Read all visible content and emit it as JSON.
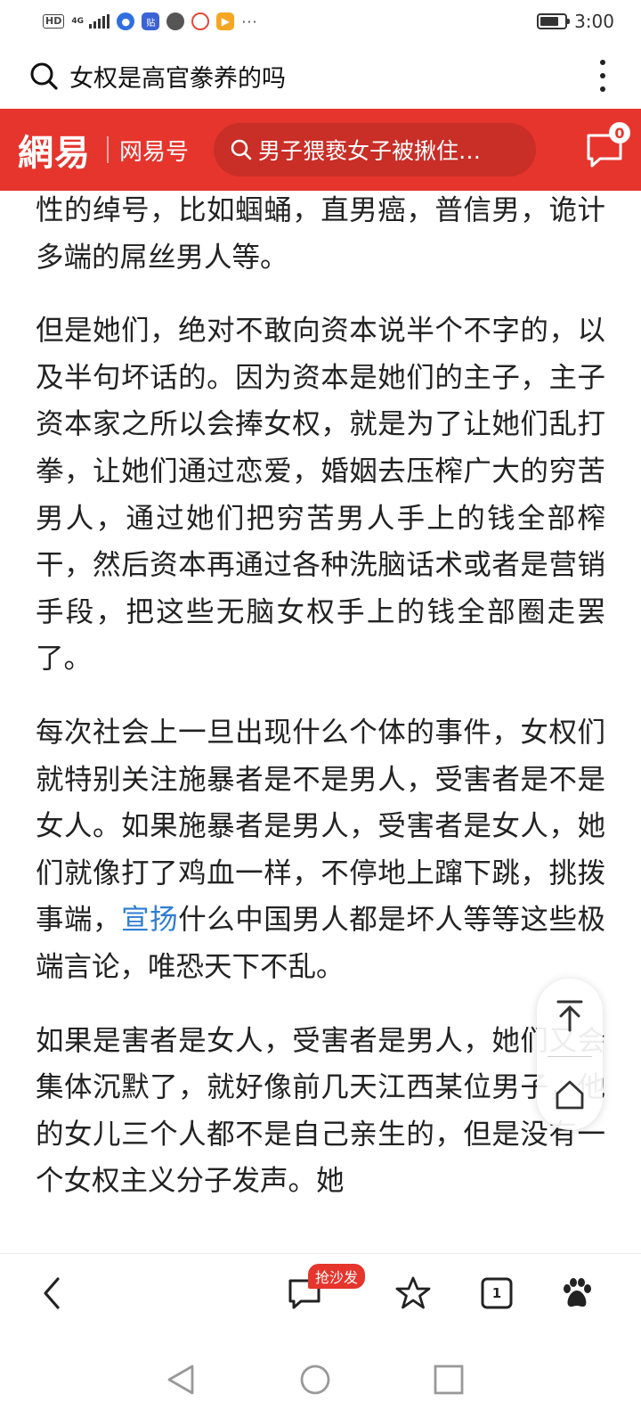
{
  "status_bar": {
    "hd": "HD",
    "network": "4G",
    "time": "3:00",
    "app_icons": [
      "baidu-icon",
      "tieba-icon",
      "chat-icon",
      "camera-icon",
      "video-icon"
    ],
    "more": "···",
    "battery_level": 0.75
  },
  "browser": {
    "query": "女权是高官豢养的吗"
  },
  "netease": {
    "logo": "網易",
    "sub_label": "网易号",
    "search_text": "男子猥亵女子被揪住…",
    "message_count": "0",
    "brand_color": "#e5352d"
  },
  "article": {
    "p1": "性的绰号，比如蝈蛹，直男癌，普信男，诡计多端的屌丝男人等。",
    "p2": "但是她们，绝对不敢向资本说半个不字的，以及半句坏话的。因为资本是她们的主子，主子资本家之所以会捧女权，就是为了让她们乱打拳，让她们通过恋爱，婚姻去压榨广大的穷苦男人，通过她们把穷苦男人手上的钱全部榨干，然后资本再通过各种洗脑话术或者是营销手段，把这些无脑女权手上的钱全部圈走罢了。",
    "p3_before": "每次社会上一旦出现什么个体的事件，女权们就特别关注施暴者是不是男人，受害者是不是女人。如果施暴者是男人，受害者是女人，她们就像打了鸡血一样，不停地上蹿下跳，挑拨事端，",
    "p3_link": "宣扬",
    "p3_after": "什么中国男人都是坏人等等这些极端言论，唯恐天下不乱。",
    "p4": "如果是害者是女人，受害者是男人，她们又会集体沉默了，就好像前几天江西某位男子，他的女儿三个人都不是自己亲生的，但是没有一个女权主义分子发声。她"
  },
  "bottom_bar": {
    "sofa_badge": "抢沙发",
    "tab_count": "1"
  }
}
